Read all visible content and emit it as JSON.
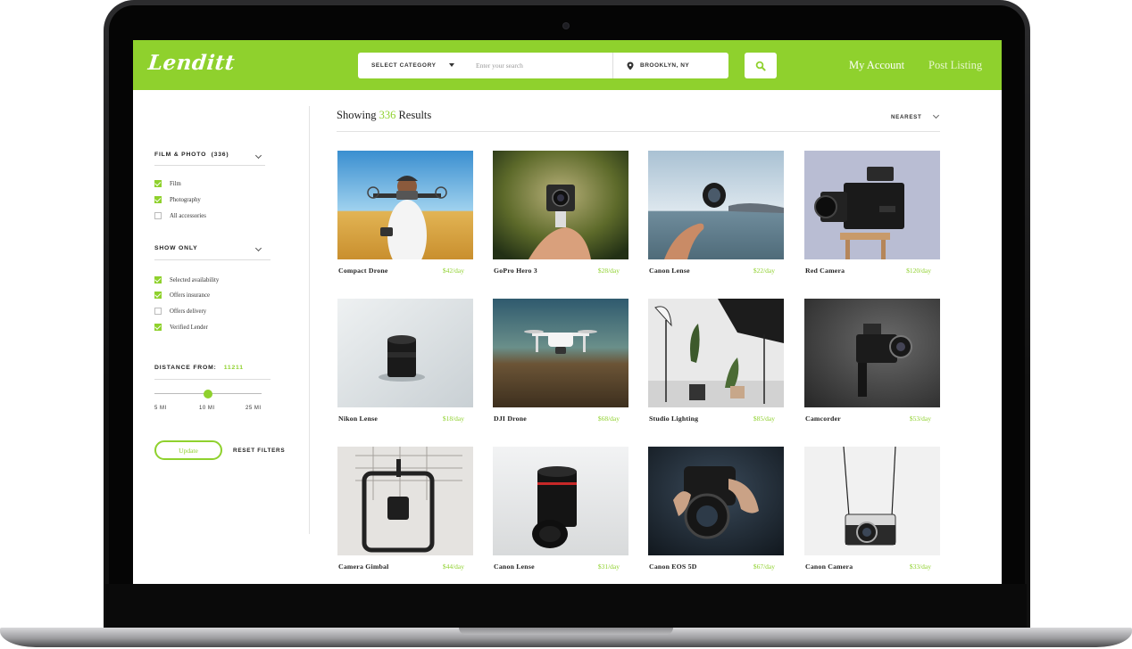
{
  "brand": {
    "logo": "Lenditt",
    "accent_color": "#8fd12d"
  },
  "header": {
    "category_label": "SELECT CATEGORY",
    "search_placeholder": "Enter your search",
    "location": "BROOKLYN, NY",
    "nav": {
      "account": "My Account",
      "post": "Post Listing"
    }
  },
  "sidebar": {
    "category_filter": {
      "title": "FILM & PHOTO",
      "count": "(336)",
      "options": [
        {
          "label": "Film",
          "checked": true
        },
        {
          "label": "Photography",
          "checked": true
        },
        {
          "label": "All accessories",
          "checked": false
        }
      ]
    },
    "show_only": {
      "title": "SHOW ONLY",
      "options": [
        {
          "label": "Selected availability",
          "checked": true
        },
        {
          "label": "Offers insurance",
          "checked": true
        },
        {
          "label": "Offers delivery",
          "checked": false
        },
        {
          "label": "Verified Lender",
          "checked": true
        }
      ]
    },
    "distance": {
      "title": "DISTANCE FROM:",
      "zip": "11211",
      "labels": [
        "5 MI",
        "10 MI",
        "25 MI"
      ],
      "value_fraction": 0.5
    },
    "update_label": "Update",
    "reset_label": "RESET FILTERS"
  },
  "results": {
    "prefix": "Showing",
    "count": "336",
    "suffix": "Results",
    "sort": "NEAREST"
  },
  "listings": [
    {
      "name": "Compact Drone",
      "price": "$42/day",
      "image": "drone-field"
    },
    {
      "name": "GoPro Hero 3",
      "price": "$28/day",
      "image": "gopro-hand"
    },
    {
      "name": "Canon Lense",
      "price": "$22/day",
      "image": "lens-sea"
    },
    {
      "name": "Red Camera",
      "price": "$120/day",
      "image": "red-camera"
    },
    {
      "name": "Nikon Lense",
      "price": "$18/day",
      "image": "lens-white"
    },
    {
      "name": "DJI Drone",
      "price": "$68/day",
      "image": "drone-valley"
    },
    {
      "name": "Studio Lighting",
      "price": "$85/day",
      "image": "studio"
    },
    {
      "name": "Camcorder",
      "price": "$53/day",
      "image": "camcorder"
    },
    {
      "name": "Camera Gimbal",
      "price": "$44/day",
      "image": "gimbal"
    },
    {
      "name": "Canon Lense",
      "price": "$31/day",
      "image": "canon-lens"
    },
    {
      "name": "Canon EOS 5D",
      "price": "$67/day",
      "image": "eos-hands"
    },
    {
      "name": "Canon Camera",
      "price": "$33/day",
      "image": "canon-strap"
    }
  ]
}
